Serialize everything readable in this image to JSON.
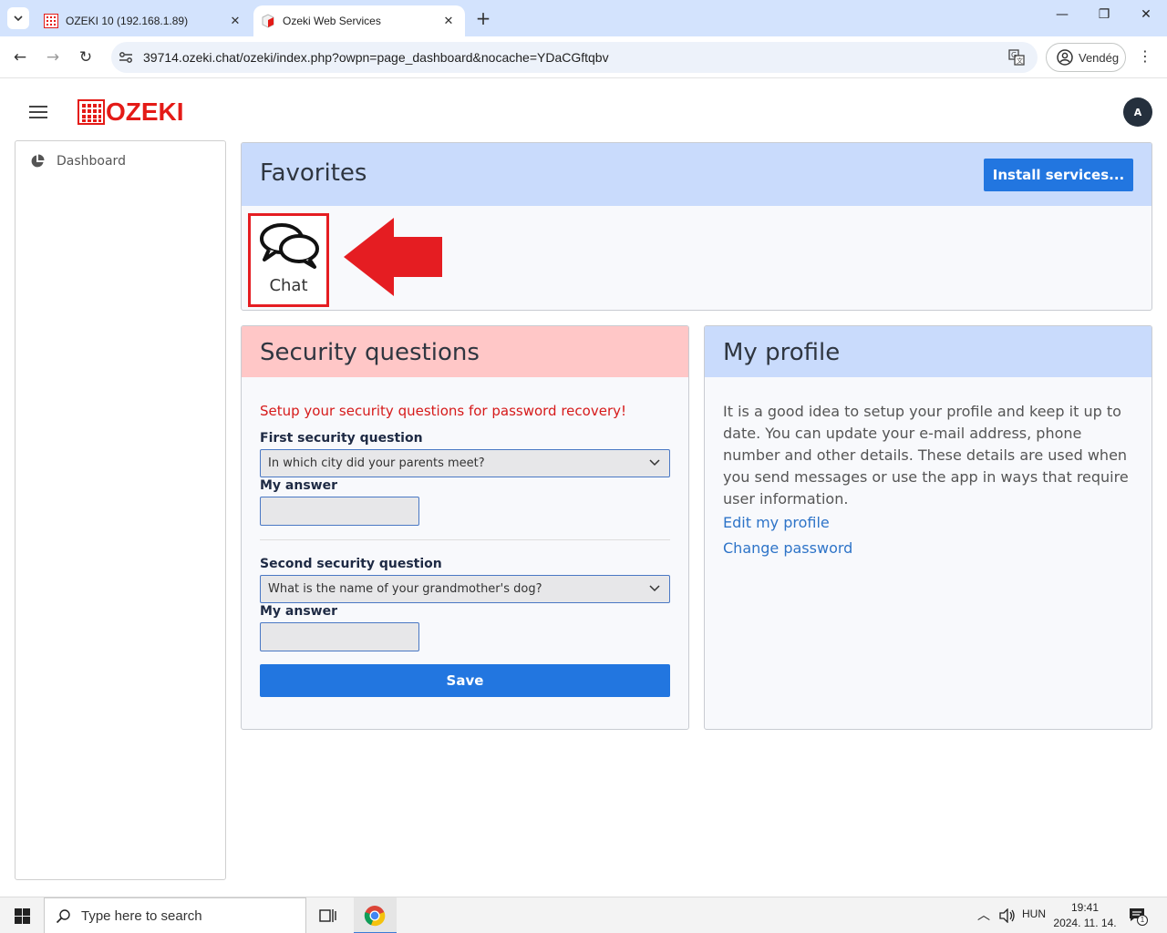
{
  "browser": {
    "tabs": [
      {
        "title": "OZEKI 10 (192.168.1.89)",
        "active": false
      },
      {
        "title": "Ozeki Web Services",
        "active": true
      }
    ],
    "url": "39714.ozeki.chat/ozeki/index.php?owpn=page_dashboard&nocache=YDaCGftqbv",
    "profile_label": "Vendég"
  },
  "header": {
    "logo_text": "OZEKI",
    "avatar_letter": "A"
  },
  "sidebar": {
    "items": [
      {
        "label": "Dashboard",
        "icon": "pie-chart-icon"
      }
    ]
  },
  "favorites": {
    "title": "Favorites",
    "install_label": "Install services...",
    "tiles": [
      {
        "label": "Chat",
        "icon": "chat-bubbles-icon"
      }
    ]
  },
  "security": {
    "title": "Security questions",
    "warning": "Setup your security questions for password recovery!",
    "first_label": "First security question",
    "first_value": "In which city did your parents meet?",
    "first_answer_label": "My answer",
    "second_label": "Second security question",
    "second_value": "What is the name of your grandmother's dog?",
    "second_answer_label": "My answer",
    "save_label": "Save"
  },
  "profile": {
    "title": "My profile",
    "description": "It is a good idea to setup your profile and keep it up to date. You can update your e-mail address, phone number and other details. These details are used when you send messages or use the app in ways that require user information.",
    "edit_link": "Edit my profile",
    "password_link": "Change password"
  },
  "taskbar": {
    "search_placeholder": "Type here to search",
    "language": "HUN",
    "time": "19:41",
    "date": "2024. 11. 14.",
    "notification_count": "1"
  },
  "colors": {
    "brand_red": "#e41b17",
    "primary_blue": "#2276e0",
    "favorites_header": "#c9dbfc",
    "security_header": "#ffc7c7",
    "highlight_red": "#e51d22"
  }
}
